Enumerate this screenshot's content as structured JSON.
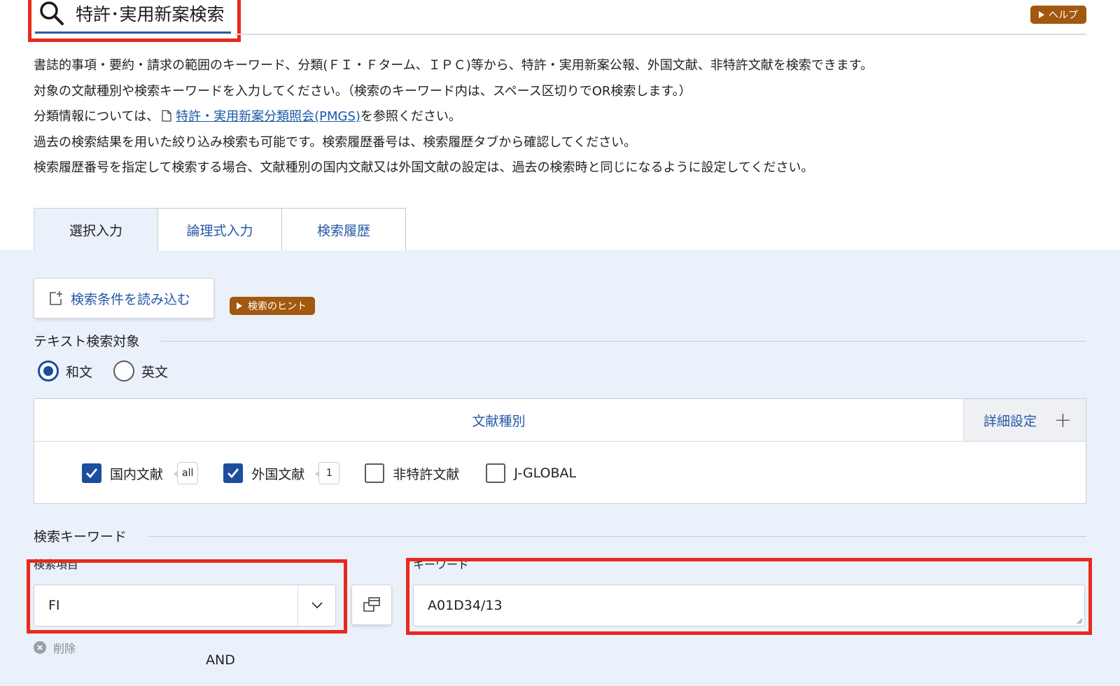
{
  "header": {
    "title": "特許･実用新案検索",
    "help_label": "ヘルプ"
  },
  "intro": {
    "line1": "書誌的事項・要約・請求の範囲のキーワード、分類(ＦＩ・Ｆターム、ＩＰＣ)等から、特許・実用新案公報、外国文献、非特許文献を検索できます。",
    "line2": "対象の文献種別や検索キーワードを入力してください。（検索のキーワード内は、スペース区切りでOR検索します。）",
    "line3_prefix": "分類情報については、",
    "line3_link": "特許・実用新案分類照会(PMGS)",
    "line3_suffix": "を参照ください。",
    "line4": "過去の検索結果を用いた絞り込み検索も可能です。検索履歴番号は、検索履歴タブから確認してください。",
    "line5": "検索履歴番号を指定して検索する場合、文献種別の国内文献又は外国文献の設定は、過去の検索時と同じになるように設定してください。"
  },
  "tabs": [
    {
      "label": "選択入力",
      "active": true
    },
    {
      "label": "論理式入力",
      "active": false
    },
    {
      "label": "検索履歴",
      "active": false
    }
  ],
  "panel": {
    "load_button": "検索条件を読み込む",
    "hint_button": "検索のヒント",
    "text_target_label": "テキスト検索対象",
    "radios": [
      {
        "label": "和文",
        "selected": true
      },
      {
        "label": "英文",
        "selected": false
      }
    ],
    "doc_type": {
      "title": "文献種別",
      "detail_label": "詳細設定",
      "items": [
        {
          "label": "国内文献",
          "checked": true,
          "badge": "all"
        },
        {
          "label": "外国文献",
          "checked": true,
          "badge": "1"
        },
        {
          "label": "非特許文献",
          "checked": false,
          "badge": null
        },
        {
          "label": "J-GLOBAL",
          "checked": false,
          "badge": null
        }
      ]
    },
    "keyword_section_label": "検索キーワード",
    "search_item_label": "検索項目",
    "search_item_value": "FI",
    "keyword_label": "キーワード",
    "keyword_value": "A01D34/13",
    "delete_label": "削除",
    "and_label": "AND"
  },
  "colors": {
    "highlight": "#e8291c",
    "accent": "#1c4e9d",
    "link": "#1a58a8",
    "hint_button": "#a3580f",
    "panel_bg": "#eaf1fb"
  }
}
